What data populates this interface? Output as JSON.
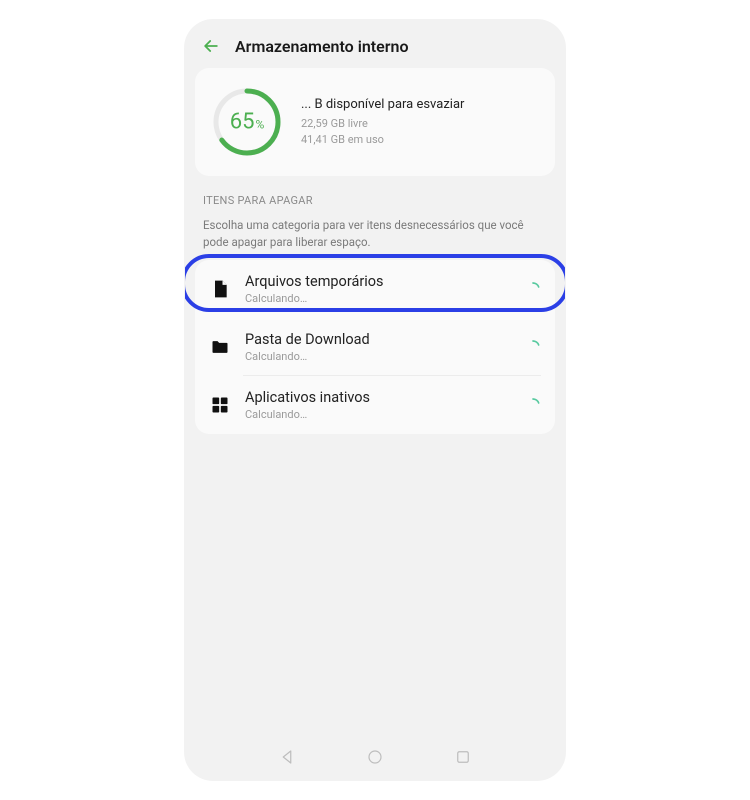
{
  "header": {
    "title": "Armazenamento interno"
  },
  "storage": {
    "percent": "65",
    "percent_symbol": "%",
    "available_label": "... B disponível para esvaziar",
    "free_label": "22,59 GB livre",
    "used_label": "41,41 GB em uso",
    "ring_percent": 65
  },
  "section": {
    "label": "ITENS PARA APAGAR",
    "description": "Escolha uma categoria para ver itens desnecessários que você pode apagar para liberar espaço."
  },
  "items": [
    {
      "title": "Arquivos temporários",
      "sub": "Calculando…",
      "icon": "file"
    },
    {
      "title": "Pasta de Download",
      "sub": "Calculando…",
      "icon": "folder"
    },
    {
      "title": "Aplicativos inativos",
      "sub": "Calculando…",
      "icon": "apps"
    }
  ],
  "colors": {
    "accent_green": "#4caf50",
    "spinner_green": "#57c99f",
    "highlight_blue": "#2b3fe6"
  }
}
